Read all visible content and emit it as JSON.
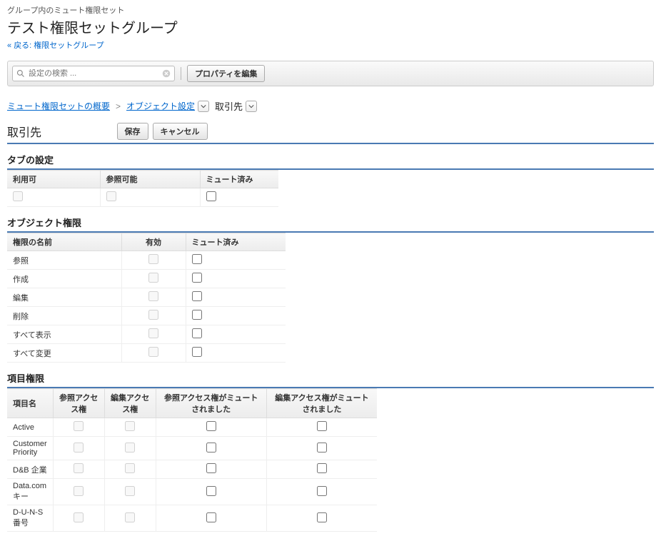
{
  "header": {
    "context": "グループ内のミュート権限セット",
    "title": "テスト権限セットグループ",
    "back_label": "戻る: 権限セットグループ"
  },
  "toolbar": {
    "search_placeholder": "設定の検索 ...",
    "edit_properties_label": "プロパティを編集"
  },
  "breadcrumb": {
    "root": "ミュート権限セットの概要",
    "obj_settings": "オブジェクト設定",
    "current": "取引先"
  },
  "section": {
    "title": "取引先",
    "save_label": "保存",
    "cancel_label": "キャンセル"
  },
  "tab_settings": {
    "heading": "タブの設定",
    "cols": {
      "available": "利用可",
      "visible": "参照可能",
      "muted": "ミュート済み"
    }
  },
  "object_perms": {
    "heading": "オブジェクト権限",
    "cols": {
      "name": "権限の名前",
      "enabled": "有効",
      "muted": "ミュート済み"
    },
    "rows": [
      {
        "name": "参照"
      },
      {
        "name": "作成"
      },
      {
        "name": "編集"
      },
      {
        "name": "削除"
      },
      {
        "name": "すべて表示"
      },
      {
        "name": "すべて変更"
      }
    ]
  },
  "field_perms": {
    "heading": "項目権限",
    "cols": {
      "name": "項目名",
      "read": "参照アクセス権",
      "edit": "編集アクセス権",
      "read_muted": "参照アクセス権がミュートされました",
      "edit_muted": "編集アクセス権がミュートされました"
    },
    "rows": [
      {
        "name": "Active"
      },
      {
        "name": "Customer Priority"
      },
      {
        "name": "D&B 企業"
      },
      {
        "name": "Data.com キー"
      },
      {
        "name": "D-U-N-S 番号"
      }
    ]
  }
}
